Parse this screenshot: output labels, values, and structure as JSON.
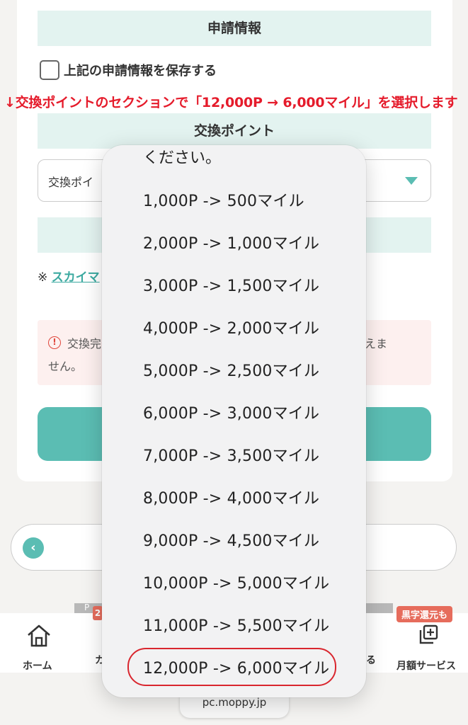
{
  "form": {
    "section_title": "申請情報",
    "save_checkbox_label": "上記の申請情報を保存する",
    "instruction": "↓交換ポイントのセクションで「12,000P → 6,000マイル」を選択します",
    "exchange_title": "交換ポイント",
    "select_placeholder": "交換ポイ",
    "note_prefix": "※",
    "note_link": "スカイマ",
    "alert_text_start": "交換完",
    "alert_text_end": "ら行えま",
    "alert_text_line2": "せん。"
  },
  "picker": {
    "heading": "ください。",
    "options": [
      "1,000P -> 500マイル",
      "2,000P -> 1,000マイル",
      "3,000P -> 1,500マイル",
      "4,000P -> 2,000マイル",
      "5,000P -> 2,500マイル",
      "6,000P -> 3,000マイル",
      "7,000P -> 3,500マイル",
      "8,000P -> 4,000マイル",
      "9,000P -> 4,500マイル",
      "10,000P -> 5,000マイル",
      "11,000P -> 5,500マイル",
      "12,000P -> 6,000マイル"
    ],
    "highlighted_option": "12,000P -> 6,000マイル"
  },
  "tabbar": {
    "home_label": "ホーム",
    "tab2_label_partial": "カ",
    "tab4_label_partial": "る",
    "monthly_label": "月額サービス",
    "badge": "黒字還元も",
    "small_badge": "2",
    "strip_letter": "P"
  },
  "browser": {
    "url": "pc.moppy.jp"
  },
  "icons": {
    "home": "home-icon",
    "monthly": "stack-icon",
    "back": "chevron-left-icon",
    "alert": "info-icon",
    "dropdown": "caret-down-icon"
  },
  "colors": {
    "accent": "#5bbdb3",
    "header_bg": "#e3f3f0",
    "instruction_red": "#e51b2b",
    "badge": "#e66c5c"
  }
}
